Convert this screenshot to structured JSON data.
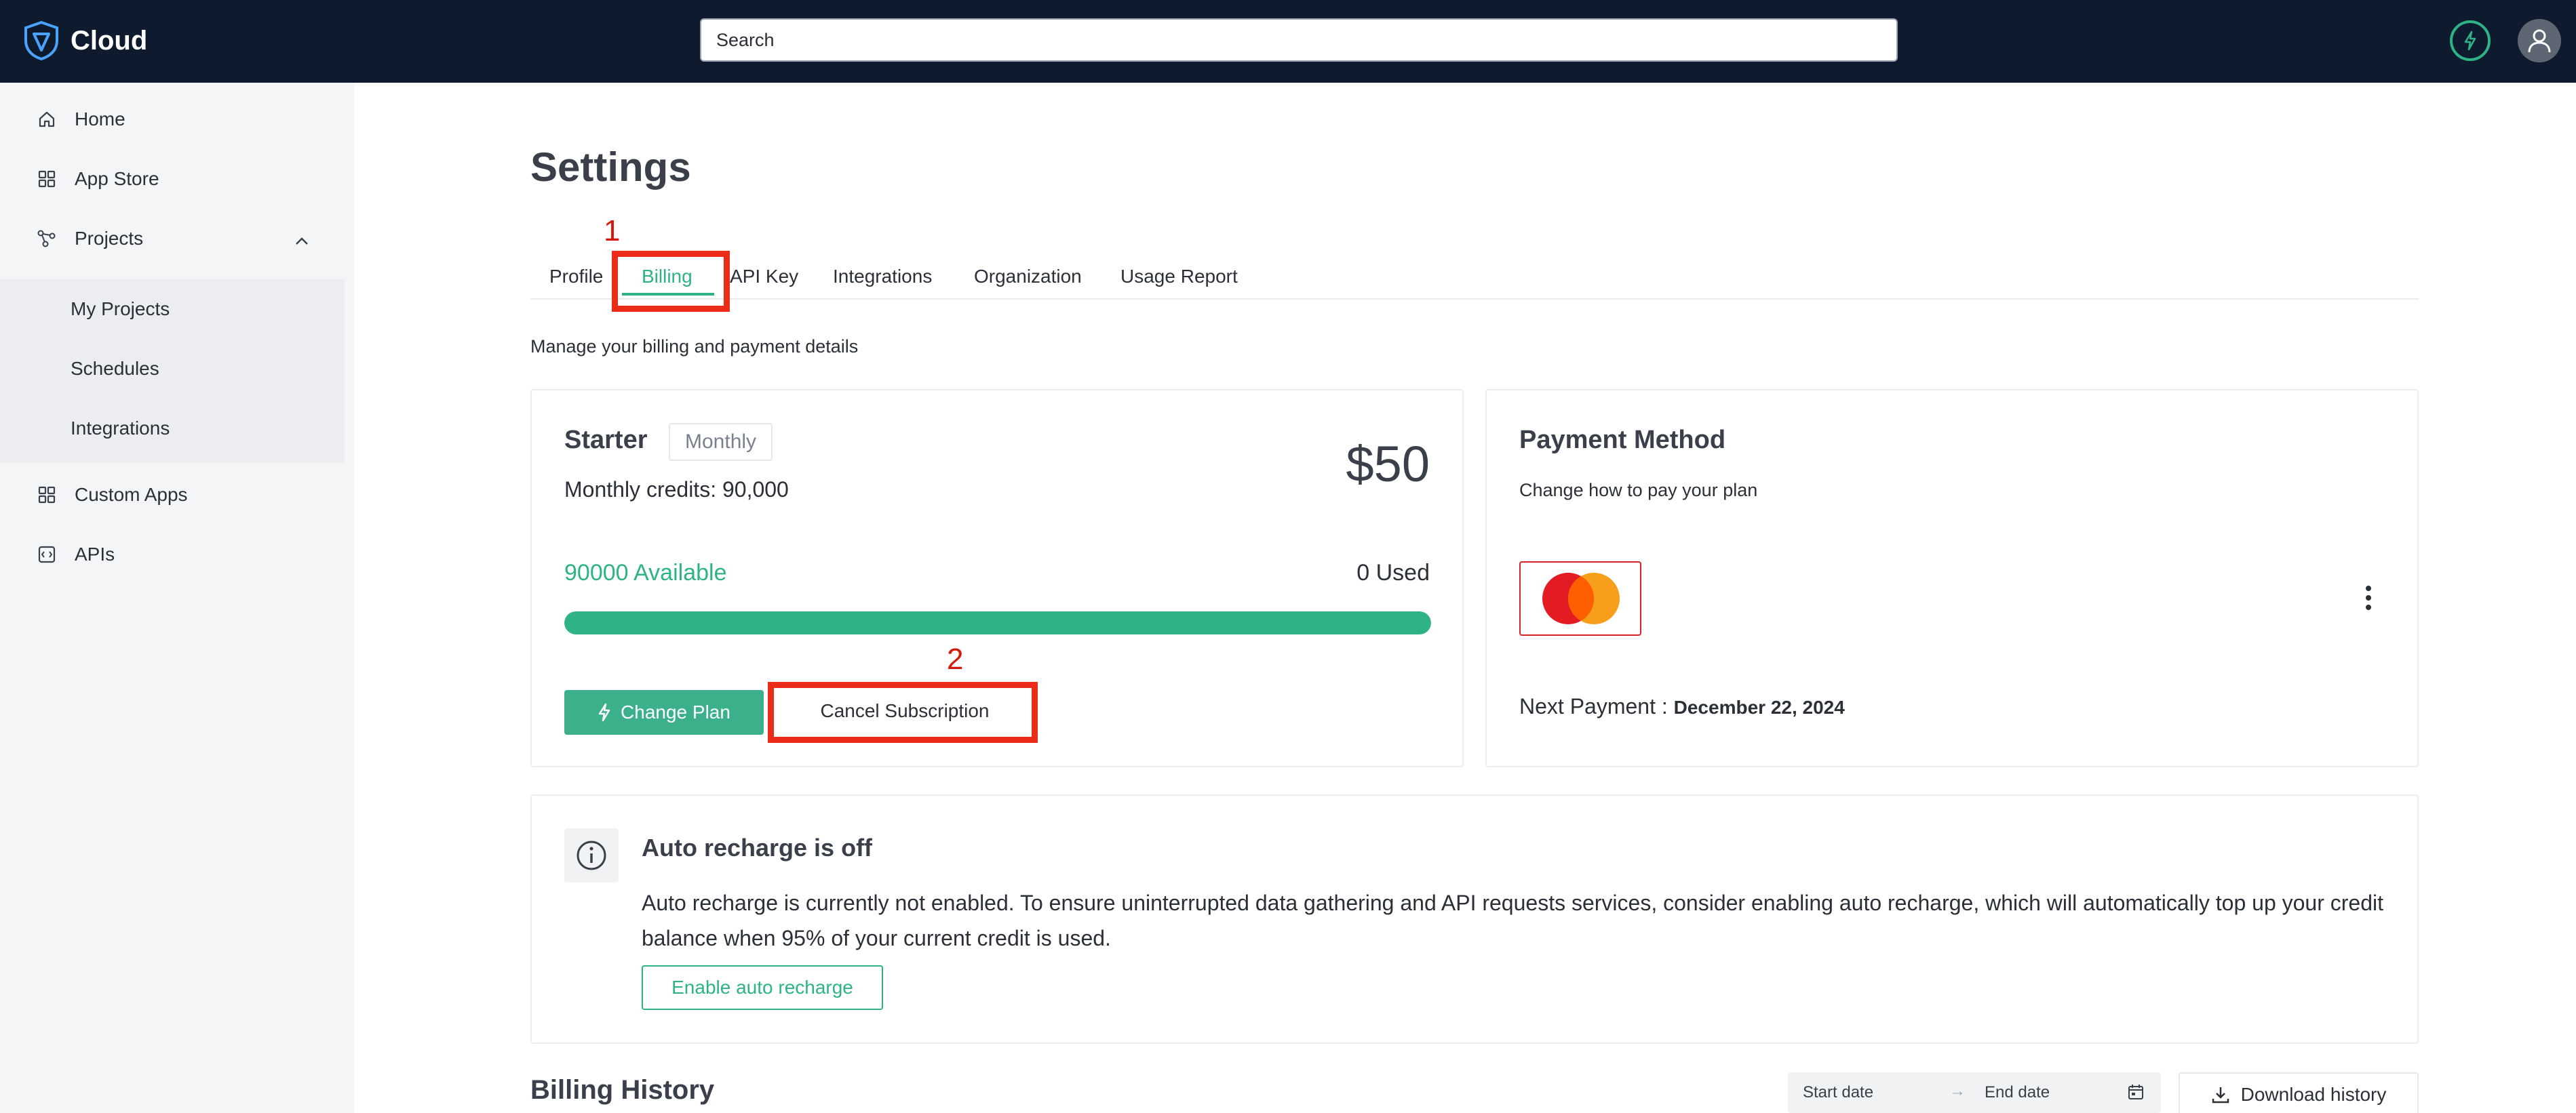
{
  "app": {
    "name": "Cloud"
  },
  "search": {
    "placeholder": "Search"
  },
  "sidebar": {
    "items": [
      {
        "label": "Home",
        "icon": "home-icon"
      },
      {
        "label": "App Store",
        "icon": "grid-icon"
      },
      {
        "label": "Projects",
        "icon": "projects-icon",
        "expanded": true
      },
      {
        "label": "Custom Apps",
        "icon": "grid-icon"
      },
      {
        "label": "APIs",
        "icon": "api-icon"
      }
    ],
    "projects_children": [
      {
        "label": "My Projects"
      },
      {
        "label": "Schedules"
      },
      {
        "label": "Integrations"
      }
    ]
  },
  "page": {
    "title": "Settings",
    "subtitle": "Manage your billing and payment details"
  },
  "tabs": [
    {
      "label": "Profile",
      "active": false
    },
    {
      "label": "Billing",
      "active": true
    },
    {
      "label": "API Key",
      "active": false
    },
    {
      "label": "Integrations",
      "active": false
    },
    {
      "label": "Organization",
      "active": false
    },
    {
      "label": "Usage Report",
      "active": false
    }
  ],
  "annotations": {
    "first": "1",
    "second": "2",
    "color": "#ec2b18"
  },
  "plan": {
    "name": "Starter",
    "cycle": "Monthly",
    "price": "$50",
    "credits_text": "Monthly credits: 90,000",
    "available_text": "90000 Available",
    "used_text": "0 Used",
    "available_fraction": 1.0,
    "change_label": "Change Plan",
    "cancel_label": "Cancel Subscription"
  },
  "payment": {
    "title": "Payment Method",
    "subtitle": "Change how to pay your plan",
    "card_brand": "mastercard-icon",
    "next_label": "Next Payment : ",
    "next_date": "December 22, 2024"
  },
  "auto_recharge": {
    "title": "Auto recharge is off",
    "text": "Auto recharge is currently not enabled. To ensure uninterrupted data gathering and API requests services, consider enabling auto recharge, which will automatically top up your credit balance when 95% of your current credit is used.",
    "button_label": "Enable auto recharge"
  },
  "billing_history": {
    "title": "Billing History",
    "start_placeholder": "Start date",
    "end_placeholder": "End date",
    "download_label": "Download history"
  },
  "colors": {
    "accent": "#2fb386",
    "topbar": "#0e1a2e",
    "sidebar": "#f4f5f7"
  }
}
